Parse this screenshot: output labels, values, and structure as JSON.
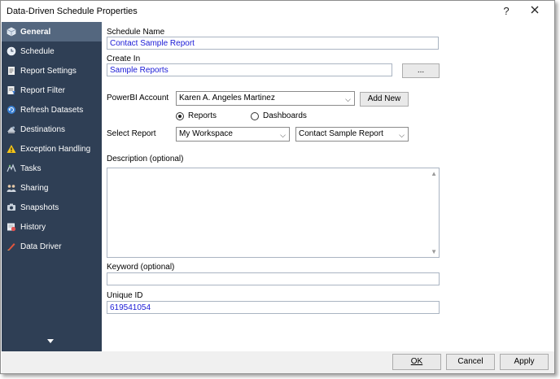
{
  "window": {
    "title": "Data-Driven Schedule Properties",
    "help_label": "?",
    "close_label": "✕"
  },
  "sidebar": {
    "items": [
      {
        "label": "General",
        "icon": "cube-icon"
      },
      {
        "label": "Schedule",
        "icon": "clock-icon"
      },
      {
        "label": "Report Settings",
        "icon": "report-icon"
      },
      {
        "label": "Report Filter",
        "icon": "filter-icon"
      },
      {
        "label": "Refresh Datasets",
        "icon": "refresh-icon"
      },
      {
        "label": "Destinations",
        "icon": "destinations-icon"
      },
      {
        "label": "Exception Handling",
        "icon": "warning-icon"
      },
      {
        "label": "Tasks",
        "icon": "tasks-icon"
      },
      {
        "label": "Sharing",
        "icon": "sharing-icon"
      },
      {
        "label": "Snapshots",
        "icon": "snapshots-icon"
      },
      {
        "label": "History",
        "icon": "history-icon"
      },
      {
        "label": "Data Driver",
        "icon": "data-driver-icon"
      }
    ],
    "active_index": 0
  },
  "form": {
    "schedule_name_label": "Schedule Name",
    "schedule_name_value": "Contact Sample Report",
    "create_in_label": "Create In",
    "create_in_value": "Sample Reports",
    "browse_label": "...",
    "powerbi_account_label": "PowerBI Account",
    "powerbi_account_value": "Karen A. Angeles Martinez",
    "add_new_label": "Add New",
    "radio_reports_label": "Reports",
    "radio_dashboards_label": "Dashboards",
    "select_report_label": "Select Report",
    "workspace_value": "My Workspace",
    "report_value": "Contact Sample Report",
    "description_label": "Description (optional)",
    "description_value": "",
    "keyword_label": "Keyword (optional)",
    "keyword_value": "",
    "unique_id_label": "Unique ID",
    "unique_id_value": "619541054"
  },
  "footer": {
    "ok_label": "OK",
    "cancel_label": "Cancel",
    "apply_label": "Apply"
  },
  "colors": {
    "sidebar_bg": "#2f3f55",
    "sidebar_active": "#54677f",
    "value_text": "#1a1ad6"
  }
}
